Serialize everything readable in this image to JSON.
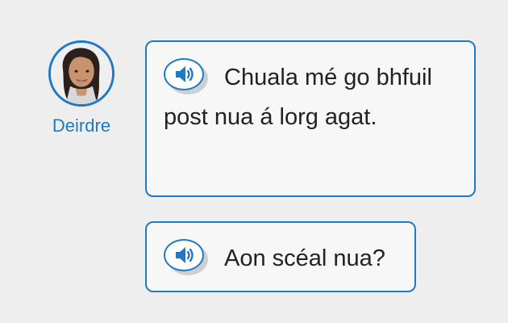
{
  "speaker": {
    "name": "Deirdre"
  },
  "messages": [
    {
      "text": "Chuala mé go bhfuil post nua á lorg agat."
    },
    {
      "text": "Aon scéal nua?"
    }
  ],
  "icons": {
    "audio": "speaker-volume-icon",
    "avatar": "person-photo"
  },
  "colors": {
    "accent": "#1f79c3",
    "background": "#eeeeee",
    "bubble": "#f7f7f7"
  }
}
